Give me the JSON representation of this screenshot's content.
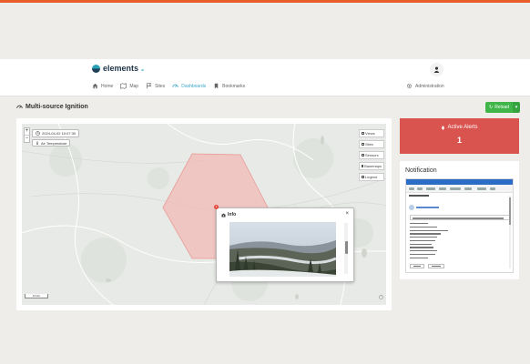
{
  "app": {
    "logo_text": "elements",
    "logo_suffix": "ai"
  },
  "nav": {
    "items": [
      {
        "label": "Home",
        "icon": "home-icon"
      },
      {
        "label": "Map",
        "icon": "map-icon"
      },
      {
        "label": "Sites",
        "icon": "sites-icon"
      },
      {
        "label": "Dashboards",
        "icon": "dashboard-icon",
        "active": true
      },
      {
        "label": "Bookmarks",
        "icon": "bookmark-icon"
      }
    ],
    "admin_label": "Administration"
  },
  "page": {
    "title": "Multi-source Ignition",
    "reload_label": "Reload"
  },
  "map": {
    "date_label": "2024-04-02 10:07:30",
    "temp_label": "Air Temperature",
    "layers": [
      {
        "label": "Views",
        "checked": false
      },
      {
        "label": "Sites",
        "checked": false
      },
      {
        "label": "Sensors",
        "checked": false
      },
      {
        "label": "Basemaps",
        "checked": true
      },
      {
        "label": "Legend",
        "checked": false
      }
    ],
    "scale_label": "10 km",
    "attribution_label": "i",
    "zoom_in": "+",
    "zoom_out": "−",
    "popup": {
      "title": "Info",
      "close": "×",
      "pin": "1"
    },
    "hexagon_color": "#f3b7b3"
  },
  "alerts": {
    "title": "Active Alerts",
    "count": "1",
    "color": "#d9534f"
  },
  "notification": {
    "title": "Notification"
  }
}
